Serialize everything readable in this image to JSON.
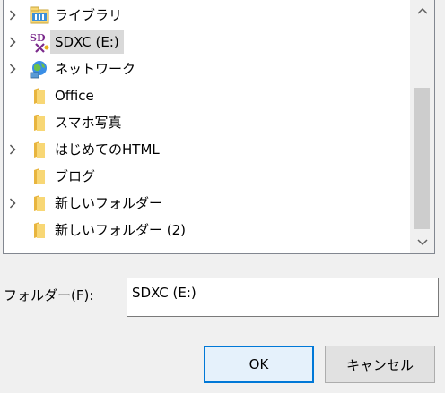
{
  "tree": {
    "items": [
      {
        "label": "ライブラリ",
        "icon": "library-icon",
        "expandable": true,
        "selected": false
      },
      {
        "label": "SDXC (E:)",
        "icon": "sd-card-drive-icon",
        "expandable": true,
        "selected": true
      },
      {
        "label": "ネットワーク",
        "icon": "network-icon",
        "expandable": true,
        "selected": false
      },
      {
        "label": "Office",
        "icon": "folder-icon",
        "expandable": false,
        "selected": false
      },
      {
        "label": "スマホ写真",
        "icon": "folder-icon",
        "expandable": false,
        "selected": false
      },
      {
        "label": "はじめてのHTML",
        "icon": "folder-icon",
        "expandable": true,
        "selected": false
      },
      {
        "label": "ブログ",
        "icon": "folder-icon",
        "expandable": false,
        "selected": false
      },
      {
        "label": "新しいフォルダー",
        "icon": "folder-icon",
        "expandable": true,
        "selected": false
      },
      {
        "label": "新しいフォルダー (2)",
        "icon": "folder-icon",
        "expandable": false,
        "selected": false
      }
    ]
  },
  "folder_field": {
    "label": "フォルダー(F):",
    "value": "SDXC (E:)"
  },
  "buttons": {
    "ok": "OK",
    "cancel": "キャンセル"
  },
  "colors": {
    "selection": "#d9d9d9",
    "folder_yellow": "#f8d775",
    "default_button_border": "#0078d7"
  }
}
